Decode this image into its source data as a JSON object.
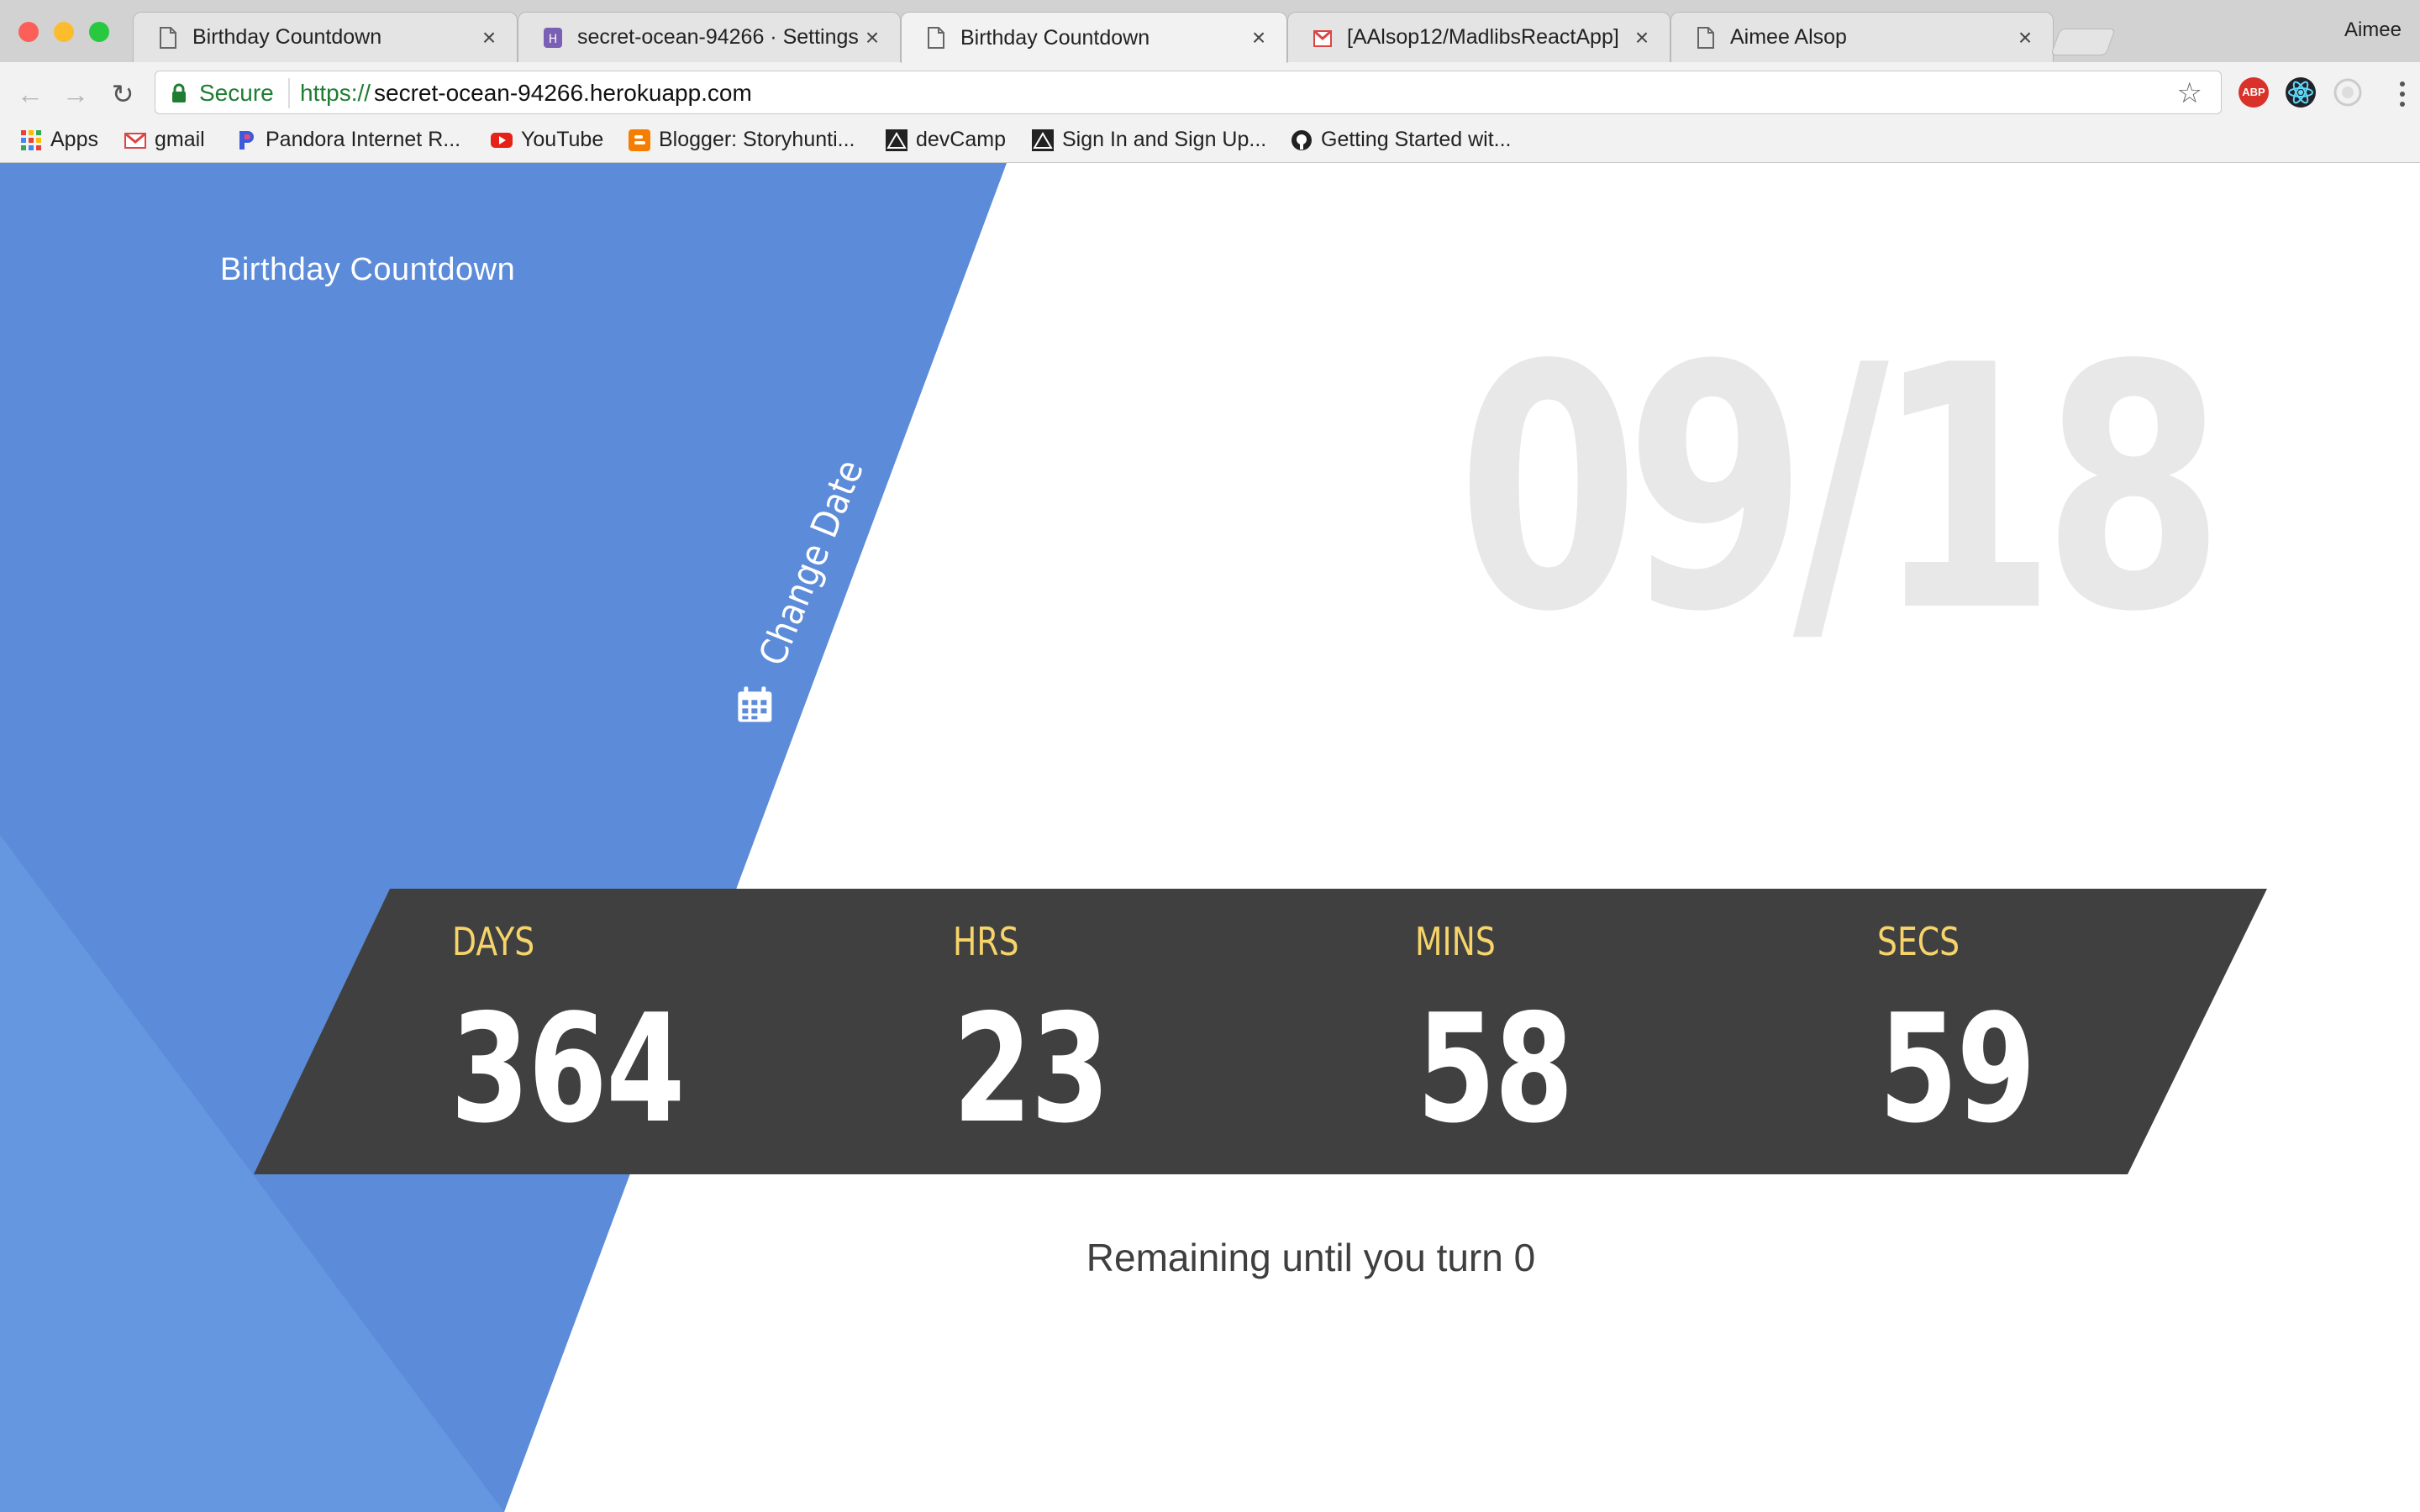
{
  "browser": {
    "tabs": [
      {
        "title": "Birthday Countdown",
        "favicon": "page-icon",
        "active": false
      },
      {
        "title": "secret-ocean-94266 · Settings",
        "favicon": "heroku-icon",
        "active": false
      },
      {
        "title": "Birthday Countdown",
        "favicon": "page-icon",
        "active": true
      },
      {
        "title": "[AAlsop12/MadlibsReactApp]",
        "favicon": "gmail-icon",
        "active": false
      },
      {
        "title": "Aimee Alsop",
        "favicon": "page-icon",
        "active": false
      }
    ],
    "profile_name": "Aimee",
    "secure_label": "Secure",
    "url_scheme": "https://",
    "url_host": "secret-ocean-94266.herokuapp.com",
    "bookmarks": [
      {
        "label": "Apps",
        "icon": "apps-grid-icon"
      },
      {
        "label": "gmail",
        "icon": "gmail-icon"
      },
      {
        "label": "Pandora Internet R...",
        "icon": "pandora-icon"
      },
      {
        "label": "YouTube",
        "icon": "youtube-icon"
      },
      {
        "label": "Blogger: Storyhunti...",
        "icon": "blogger-icon"
      },
      {
        "label": "devCamp",
        "icon": "devcamp-icon"
      },
      {
        "label": "Sign In and Sign Up...",
        "icon": "devcamp-icon"
      },
      {
        "label": "Getting Started wit...",
        "icon": "github-icon"
      }
    ],
    "extensions": [
      {
        "name": "adblock-icon",
        "label": "ABP"
      },
      {
        "name": "react-devtools-icon"
      },
      {
        "name": "extension-icon"
      }
    ]
  },
  "app": {
    "title": "Birthday Countdown",
    "change_date_label": "Change Date",
    "target_date": "09/18",
    "countdown": [
      {
        "label": "DAYS",
        "value": "364"
      },
      {
        "label": "HRS",
        "value": "23"
      },
      {
        "label": "MINS",
        "value": "58"
      },
      {
        "label": "SECS",
        "value": "59"
      }
    ],
    "remaining_text": "Remaining until you turn 0"
  },
  "colors": {
    "primary_blue": "#5b8bd9",
    "light_blue": "#6497e0",
    "countdown_bg": "#404040",
    "label_yellow": "#f6d46a",
    "date_watermark": "#e8e8e8"
  }
}
